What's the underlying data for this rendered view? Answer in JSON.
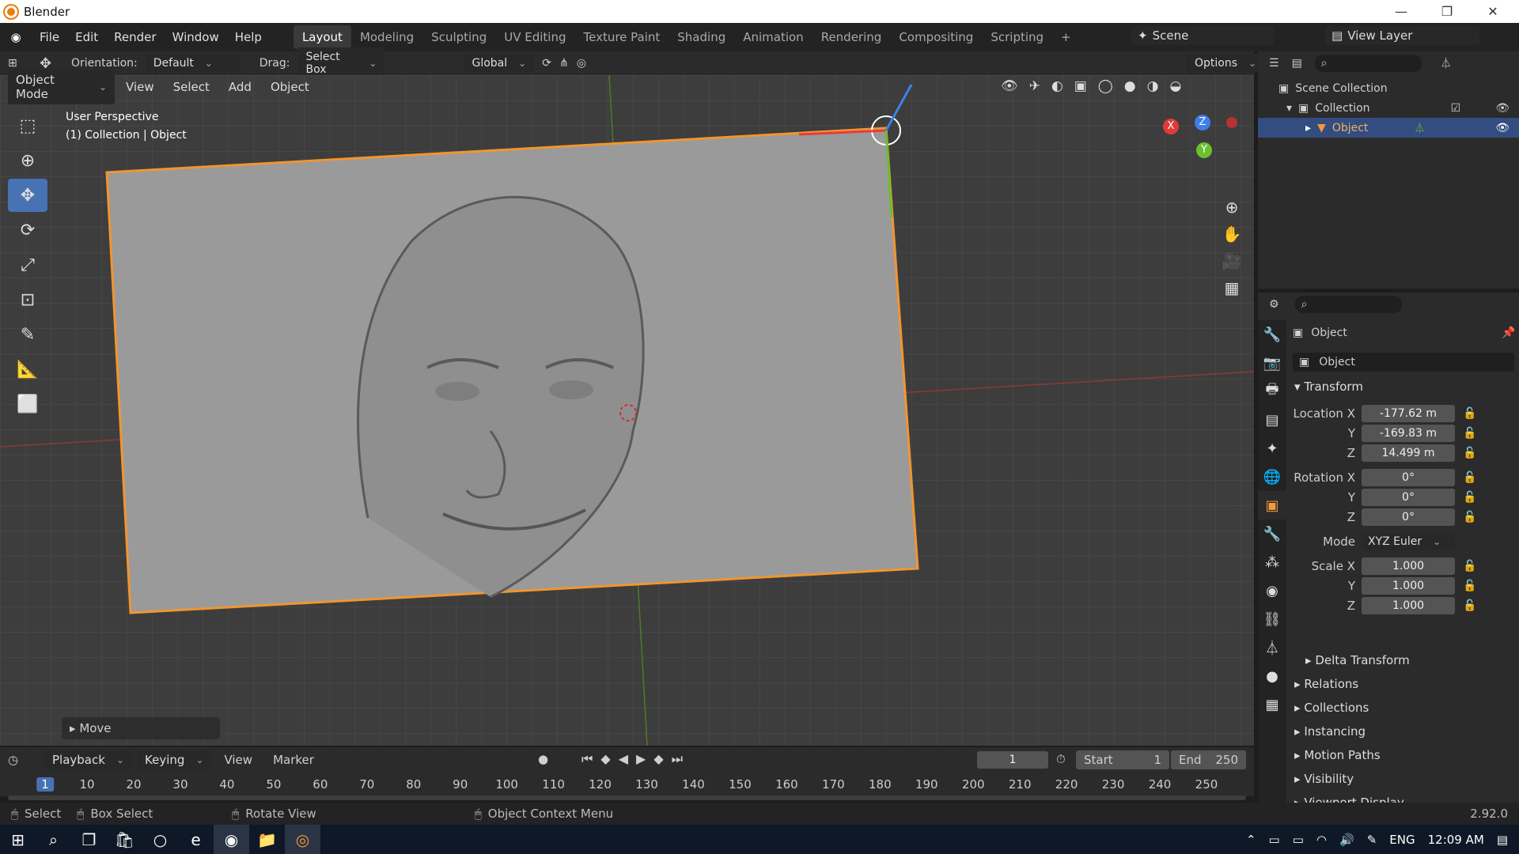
{
  "window": {
    "title": "Blender"
  },
  "menus": [
    "File",
    "Edit",
    "Render",
    "Window",
    "Help"
  ],
  "workspaces": [
    "Layout",
    "Modeling",
    "Sculpting",
    "UV Editing",
    "Texture Paint",
    "Shading",
    "Animation",
    "Rendering",
    "Compositing",
    "Scripting"
  ],
  "scene": "Scene",
  "view_layer": "View Layer",
  "tool_header": {
    "orientation_label": "Orientation:",
    "orientation_value": "Default",
    "drag_label": "Drag:",
    "drag_value": "Select Box",
    "transform_value": "Global",
    "options": "Options"
  },
  "viewport_header": {
    "mode": "Object Mode",
    "view": "View",
    "select": "Select",
    "add": "Add",
    "object": "Object"
  },
  "viewport_overlay": {
    "perspective": "User Perspective",
    "context": "(1) Collection | Object",
    "gizmo_x": "X",
    "gizmo_y": "Y",
    "gizmo_z": "Z"
  },
  "operator_panel": "Move",
  "outliner": {
    "scene_collection": "Scene Collection",
    "collection": "Collection",
    "object": "Object"
  },
  "properties": {
    "object_name": "Object",
    "object_field": "Object",
    "transform": "Transform",
    "location_label": "Location X",
    "loc": [
      "-177.62 m",
      "-169.83 m",
      "14.499 m"
    ],
    "rotation_label": "Rotation X",
    "rot": [
      "0°",
      "0°",
      "0°"
    ],
    "mode_label": "Mode",
    "mode": "XYZ Euler",
    "scale_label": "Scale X",
    "scale": [
      "1.000",
      "1.000",
      "1.000"
    ],
    "axis_y": "Y",
    "axis_z": "Z",
    "sections": [
      "Delta Transform",
      "Relations",
      "Collections",
      "Instancing",
      "Motion Paths",
      "Visibility",
      "Viewport Display"
    ]
  },
  "timeline": {
    "playback": "Playback",
    "keying": "Keying",
    "view": "View",
    "marker": "Marker",
    "current": "1",
    "start_label": "Start",
    "start": "1",
    "end_label": "End",
    "end": "250",
    "ticks": [
      "1",
      "10",
      "20",
      "30",
      "40",
      "50",
      "60",
      "70",
      "80",
      "90",
      "100",
      "110",
      "120",
      "130",
      "140",
      "150",
      "160",
      "170",
      "180",
      "190",
      "200",
      "210",
      "220",
      "230",
      "240",
      "250"
    ]
  },
  "status": {
    "select": "Select",
    "box": "Box Select",
    "rotate": "Rotate View",
    "context": "Object Context Menu",
    "version": "2.92.0"
  },
  "taskbar": {
    "lang": "ENG",
    "time": "12:09 AM"
  }
}
